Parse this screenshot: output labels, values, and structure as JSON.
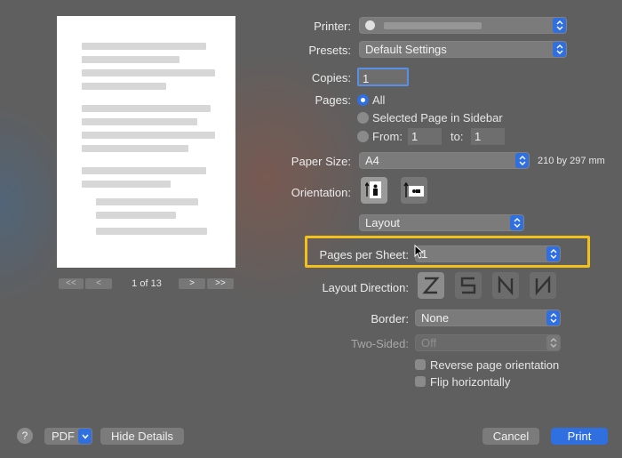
{
  "preview": {
    "page_indicator": "1 of 13",
    "nav_first": "<<",
    "nav_prev": "<",
    "nav_next": ">",
    "nav_last": ">>"
  },
  "printer": {
    "label": "Printer:"
  },
  "presets": {
    "label": "Presets:",
    "value": "Default Settings"
  },
  "copies": {
    "label": "Copies:",
    "value": "1"
  },
  "pages": {
    "label": "Pages:",
    "option_all": "All",
    "option_selected": "Selected Page in Sidebar",
    "option_from": "From:",
    "from_value": "1",
    "to_label": "to:",
    "to_value": "1",
    "selected_option": "All"
  },
  "paper_size": {
    "label": "Paper Size:",
    "value": "A4",
    "dimensions": "210 by 297 mm"
  },
  "orientation": {
    "label": "Orientation:",
    "selected": "portrait"
  },
  "section": {
    "value": "Layout"
  },
  "pages_per_sheet": {
    "label": "Pages per Sheet:",
    "value": "1",
    "highlight_color": "#f2c21b"
  },
  "layout_direction": {
    "label": "Layout Direction:"
  },
  "border": {
    "label": "Border:",
    "value": "None"
  },
  "two_sided": {
    "label": "Two-Sided:",
    "value": "Off"
  },
  "reverse_orientation": {
    "label": "Reverse page orientation",
    "checked": false
  },
  "flip_horizontally": {
    "label": "Flip horizontally",
    "checked": false
  },
  "footer": {
    "help": "?",
    "pdf": "PDF",
    "hide_details": "Hide Details",
    "cancel": "Cancel",
    "print": "Print"
  },
  "colors": {
    "accent": "#2f6fe0",
    "background": "#5f5f5f"
  }
}
